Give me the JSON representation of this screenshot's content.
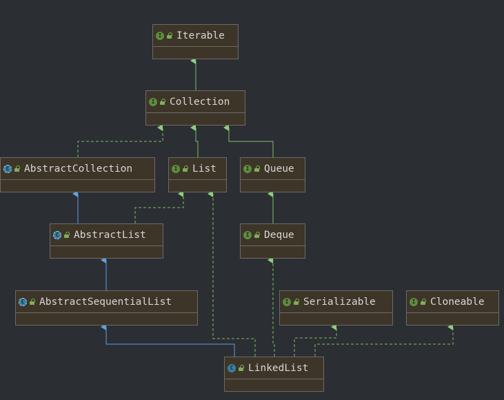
{
  "diagram": {
    "nodes": {
      "iterable": {
        "label": "Iterable",
        "kind_badge": "I"
      },
      "collection": {
        "label": "Collection",
        "kind_badge": "I"
      },
      "abstract_collection": {
        "label": "AbstractCollection",
        "kind_badge": "C"
      },
      "list": {
        "label": "List",
        "kind_badge": "I"
      },
      "queue": {
        "label": "Queue",
        "kind_badge": "I"
      },
      "abstract_list": {
        "label": "AbstractList",
        "kind_badge": "C"
      },
      "deque": {
        "label": "Deque",
        "kind_badge": "I"
      },
      "abstract_sequential_list": {
        "label": "AbstractSequentialList",
        "kind_badge": "C"
      },
      "serializable": {
        "label": "Serializable",
        "kind_badge": "I"
      },
      "cloneable": {
        "label": "Cloneable",
        "kind_badge": "I"
      },
      "linked_list": {
        "label": "LinkedList",
        "kind_badge": "C"
      }
    },
    "colors": {
      "implements_edge": "#7fbf6a",
      "extends_edge": "#5ea3e0",
      "node_fill": "#3e3529",
      "node_border": "#6b6b6b",
      "background": "#2b2e33"
    }
  }
}
